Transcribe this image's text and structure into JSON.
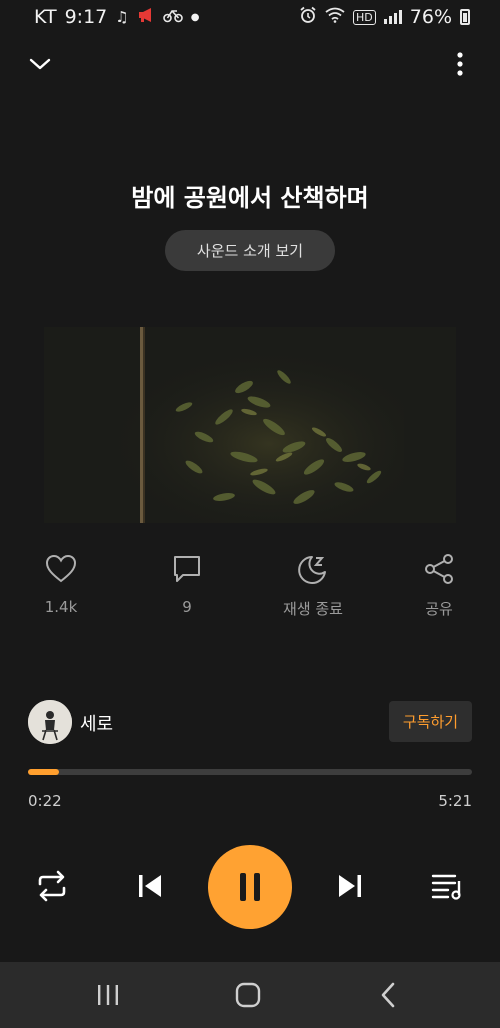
{
  "status_bar": {
    "carrier": "KT",
    "time": "9:17",
    "network": "HD",
    "battery": "76%"
  },
  "track": {
    "title": "밤에 공원에서 산책하며",
    "intro_label": "사운드 소개 보기"
  },
  "actions": {
    "likes": "1.4k",
    "comments": "9",
    "sleep_timer_label": "재생 종료",
    "share_label": "공유"
  },
  "artist": {
    "name": "세로",
    "subscribe_label": "구독하기"
  },
  "progress": {
    "current_time": "0:22",
    "total_time": "5:21",
    "fraction": 0.069
  },
  "colors": {
    "accent": "#ffa232",
    "background": "#181818"
  },
  "icons": {
    "collapse": "chevron-down-icon",
    "more": "more-vertical-icon",
    "like": "heart-icon",
    "comment": "comment-icon",
    "sleep": "moon-sleep-icon",
    "share": "share-icon",
    "repeat": "repeat-icon",
    "previous": "skip-previous-icon",
    "pause": "pause-icon",
    "next": "skip-next-icon",
    "playlist": "playlist-icon"
  }
}
